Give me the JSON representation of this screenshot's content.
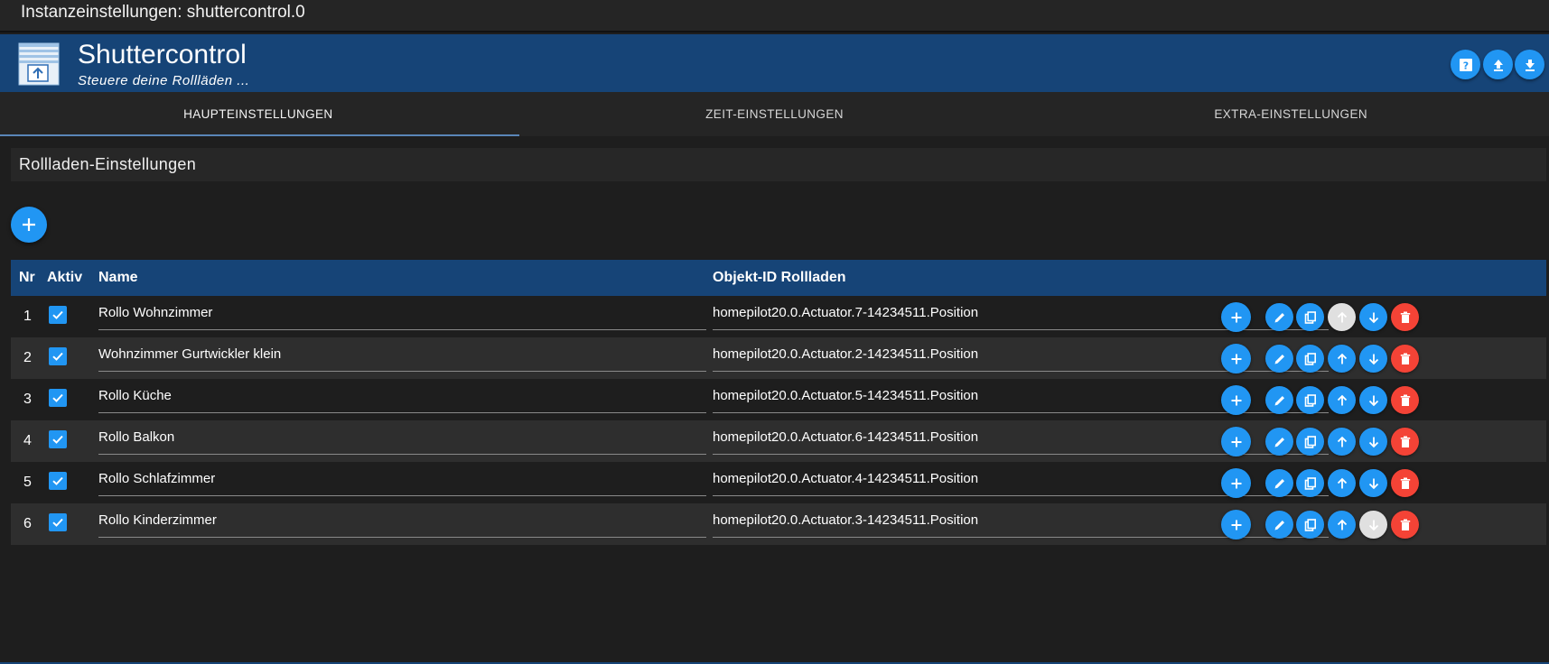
{
  "window": {
    "title": "Instanzeinstellungen: shuttercontrol.0"
  },
  "header": {
    "app_name": "Shuttercontrol",
    "subtitle": "Steuere deine Rollläden ...",
    "buttons": [
      {
        "icon": "help-icon"
      },
      {
        "icon": "upload-icon"
      },
      {
        "icon": "download-icon"
      }
    ]
  },
  "tabs": [
    {
      "label": "HAUPTEINSTELLUNGEN",
      "active": true
    },
    {
      "label": "ZEIT-EINSTELLUNGEN",
      "active": false
    },
    {
      "label": "EXTRA-EINSTELLUNGEN",
      "active": false
    }
  ],
  "section": {
    "title": "Rollladen-Einstellungen"
  },
  "table": {
    "headers": {
      "nr": "Nr",
      "aktiv": "Aktiv",
      "name": "Name",
      "objekt": "Objekt-ID Rollladen"
    },
    "rows": [
      {
        "nr": "1",
        "aktiv": true,
        "name": "Rollo Wohnzimmer",
        "objekt": "homepilot20.0.Actuator.7-14234511.Position",
        "up_enabled": false,
        "down_enabled": true
      },
      {
        "nr": "2",
        "aktiv": true,
        "name": "Wohnzimmer Gurtwickler klein",
        "objekt": "homepilot20.0.Actuator.2-14234511.Position",
        "up_enabled": true,
        "down_enabled": true
      },
      {
        "nr": "3",
        "aktiv": true,
        "name": "Rollo Küche",
        "objekt": "homepilot20.0.Actuator.5-14234511.Position",
        "up_enabled": true,
        "down_enabled": true
      },
      {
        "nr": "4",
        "aktiv": true,
        "name": "Rollo Balkon",
        "objekt": "homepilot20.0.Actuator.6-14234511.Position",
        "up_enabled": true,
        "down_enabled": true
      },
      {
        "nr": "5",
        "aktiv": true,
        "name": "Rollo Schlafzimmer",
        "objekt": "homepilot20.0.Actuator.4-14234511.Position",
        "up_enabled": true,
        "down_enabled": true
      },
      {
        "nr": "6",
        "aktiv": true,
        "name": "Rollo Kinderzimmer",
        "objekt": "homepilot20.0.Actuator.3-14234511.Position",
        "up_enabled": true,
        "down_enabled": false
      }
    ]
  },
  "colors": {
    "accent": "#2196f3",
    "header_bg": "#164477",
    "danger": "#f44336",
    "disabled": "#e0e0e0"
  }
}
